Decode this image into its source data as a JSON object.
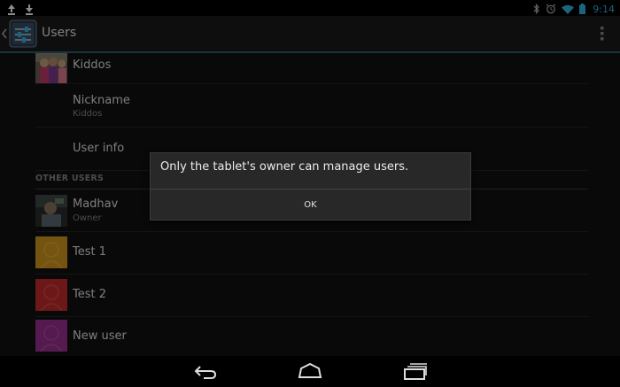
{
  "status_bar": {
    "time": "9:14",
    "left_icons": [
      "upload-icon",
      "download-icon"
    ],
    "right_icons": [
      "bluetooth-icon",
      "alarm-icon",
      "wifi-icon",
      "battery-icon"
    ]
  },
  "action_bar": {
    "title": "Users",
    "icons": [
      "up-caret-icon",
      "settings-app-icon",
      "overflow-menu-icon"
    ]
  },
  "current_user": {
    "name": "Kiddos",
    "nickname_label": "Nickname",
    "nickname_value": "Kiddos",
    "user_info_label": "User info"
  },
  "other_users": {
    "header": "OTHER USERS",
    "items": [
      {
        "name": "Madhav",
        "subtitle": "Owner",
        "avatar": "photo"
      },
      {
        "name": "Test 1",
        "subtitle": "",
        "avatar_color": "#d49a1e"
      },
      {
        "name": "Test 2",
        "subtitle": "",
        "avatar_color": "#c62c2c"
      },
      {
        "name": "New user",
        "subtitle": "",
        "avatar_color": "#9b3090"
      }
    ]
  },
  "dialog": {
    "message": "Only the tablet's owner can manage users.",
    "ok_label": "OK"
  },
  "nav_bar": {
    "buttons": [
      "back-icon",
      "home-icon",
      "recent-apps-icon"
    ]
  },
  "colors": {
    "accent": "#33b5e5",
    "action_bar_divider": "#2f5d7a"
  }
}
